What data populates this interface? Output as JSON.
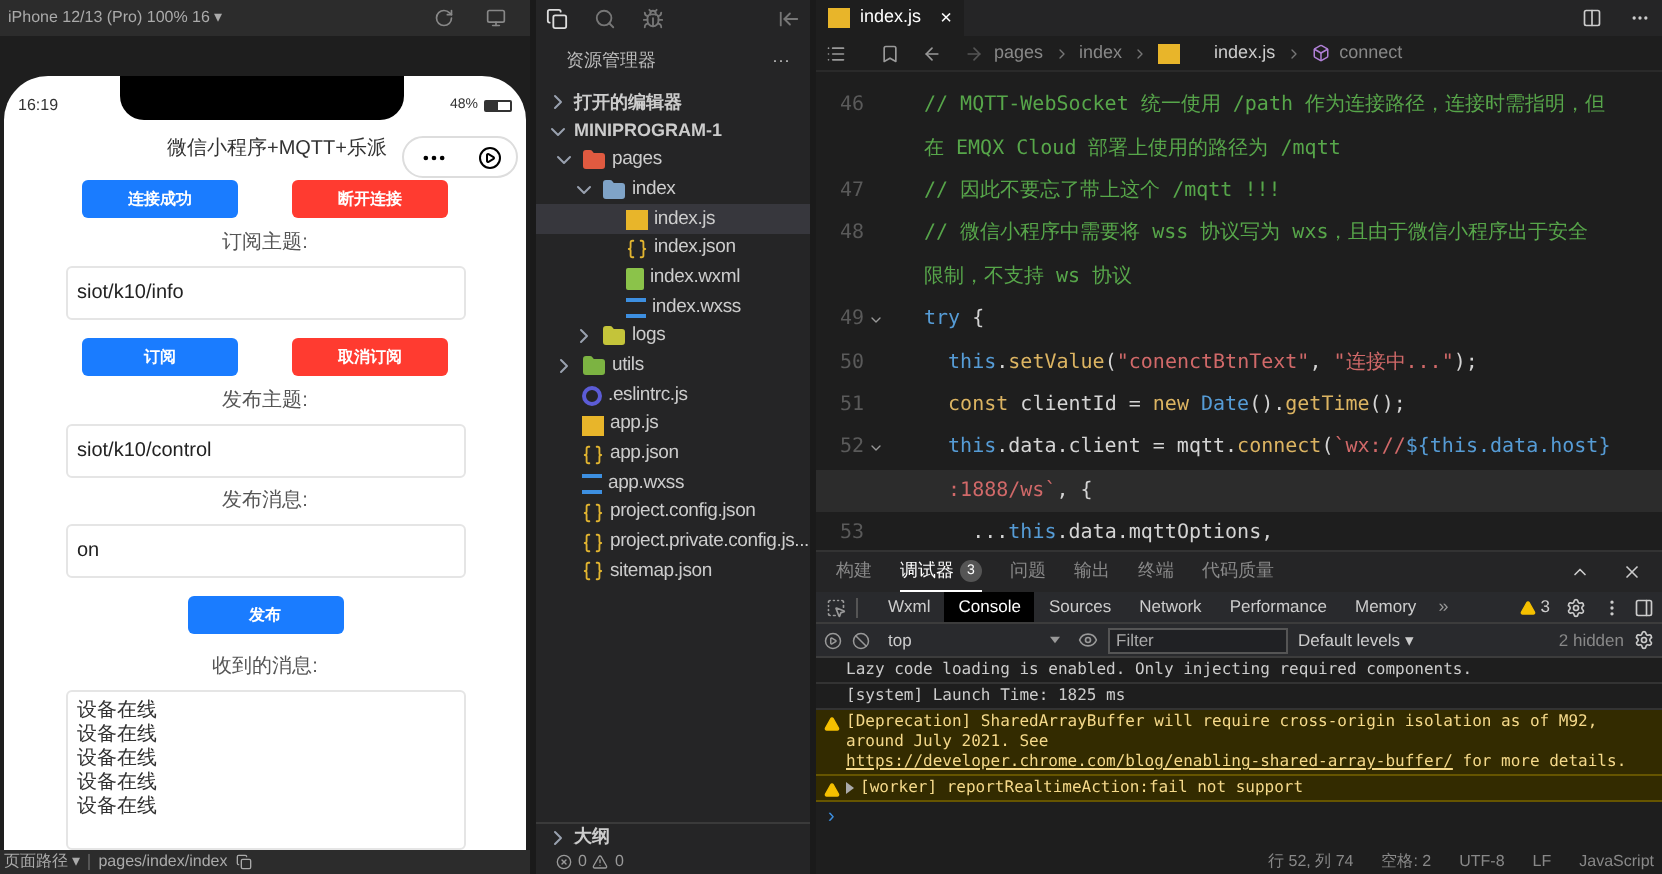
{
  "simulator": {
    "device_menu": "iPhone 12/13 (Pro) 100% 16 ▾",
    "phone": {
      "time": "16:19",
      "battery_text": "48%",
      "battery": {
        "level": 0.48
      },
      "title": "微信小程序+MQTT+乐派",
      "rows": [
        {
          "kind": "buttons",
          "buttons": [
            {
              "label": "连接成功",
              "color": "#1a7cff"
            },
            {
              "label": "断开连接",
              "color": "#ff3b30"
            }
          ]
        },
        {
          "kind": "field",
          "label": "订阅主题:",
          "value": "siot/k10/info"
        },
        {
          "kind": "buttons",
          "buttons": [
            {
              "label": "订阅",
              "color": "#1a7cff"
            },
            {
              "label": "取消订阅",
              "color": "#ff3b30"
            }
          ]
        },
        {
          "kind": "field",
          "label": "发布主题:",
          "value": "siot/k10/control"
        },
        {
          "kind": "field",
          "label": "发布消息:",
          "value": "on"
        },
        {
          "kind": "buttons",
          "buttons": [
            {
              "label": "发布",
              "color": "#1a7cff"
            }
          ]
        },
        {
          "kind": "messages",
          "label": "收到的消息:",
          "lines": [
            "设备在线",
            "设备在线",
            "设备在线",
            "设备在线",
            "设备在线"
          ]
        }
      ]
    },
    "path_label": "页面路径 ▾",
    "path": "pages/index/index"
  },
  "explorer": {
    "title": "资源管理器",
    "more": "···",
    "sections": [
      {
        "label": "打开的编辑器",
        "expanded": false
      },
      {
        "label": "MINIPROGRAM-1",
        "expanded": true
      }
    ],
    "tree": [
      {
        "name": "pages",
        "kind": "folder-pages",
        "expanded": true,
        "selected": false,
        "children": [
          {
            "name": "index",
            "kind": "folder",
            "expanded": true,
            "selected": false,
            "children": [
              {
                "name": "index.js",
                "kind": "js",
                "selected": true
              },
              {
                "name": "index.json",
                "kind": "json",
                "selected": false
              },
              {
                "name": "index.wxml",
                "kind": "wxml",
                "selected": false
              },
              {
                "name": "index.wxss",
                "kind": "wxss",
                "selected": false
              }
            ]
          },
          {
            "name": "logs",
            "kind": "folder-logs",
            "expanded": false,
            "selected": false
          }
        ]
      },
      {
        "name": "utils",
        "kind": "folder-utils",
        "expanded": false,
        "selected": false
      },
      {
        "name": ".eslintrc.js",
        "kind": "eslint",
        "selected": false
      },
      {
        "name": "app.js",
        "kind": "js",
        "selected": false
      },
      {
        "name": "app.json",
        "kind": "json",
        "selected": false
      },
      {
        "name": "app.wxss",
        "kind": "wxss",
        "selected": false
      },
      {
        "name": "project.config.json",
        "kind": "json",
        "selected": false
      },
      {
        "name": "project.private.config.js...",
        "kind": "json",
        "selected": false
      },
      {
        "name": "sitemap.json",
        "kind": "json",
        "selected": false
      }
    ],
    "outline": {
      "label": "大纲",
      "expanded": false
    },
    "errors": "0",
    "warnings": "0"
  },
  "editor": {
    "tab": {
      "label": "index.js",
      "close": "×"
    },
    "breadcrumbs": [
      "pages",
      "index",
      "index.js",
      "connect"
    ],
    "rows": [
      {
        "number": "46",
        "current": false,
        "foldable": false,
        "tokens": [
          {
            "kind": "comment",
            "text": "// MQTT-WebSocket 统一使用 /path 作为连接路径，连接时需指明，但"
          }
        ]
      },
      {
        "current": false,
        "foldable": false,
        "tokens": [
          {
            "kind": "comment",
            "text": "在 EMQX Cloud 部署上使用的路径为 /mqtt"
          }
        ]
      },
      {
        "number": "47",
        "current": false,
        "foldable": false,
        "tokens": [
          {
            "kind": "comment",
            "text": "// 因此不要忘了带上这个 /mqtt !!!"
          }
        ]
      },
      {
        "number": "48",
        "current": false,
        "foldable": false,
        "tokens": [
          {
            "kind": "comment",
            "text": "// 微信小程序中需要将 wss 协议写为 wxs，且由于微信小程序出于安全"
          }
        ]
      },
      {
        "current": false,
        "foldable": false,
        "tokens": [
          {
            "kind": "comment",
            "text": "限制，不支持 ws 协议"
          }
        ]
      },
      {
        "number": "49",
        "current": false,
        "foldable": true,
        "tokens": [
          {
            "kind": "keyword",
            "text": "try"
          },
          {
            "kind": "plain",
            "text": " {"
          }
        ]
      },
      {
        "number": "50",
        "current": false,
        "foldable": false,
        "tokens": [
          {
            "kind": "keyword",
            "text": "  this"
          },
          {
            "kind": "plain",
            "text": "."
          },
          {
            "kind": "func",
            "text": "setValue"
          },
          {
            "kind": "plain",
            "text": "("
          },
          {
            "kind": "string",
            "text": "\"conenctBtnText\""
          },
          {
            "kind": "plain",
            "text": ", "
          },
          {
            "kind": "string",
            "text": "\"连接中...\""
          },
          {
            "kind": "plain",
            "text": ");"
          }
        ]
      },
      {
        "number": "51",
        "current": false,
        "foldable": false,
        "tokens": [
          {
            "kind": "func",
            "text": "  const"
          },
          {
            "kind": "plain",
            "text": " clientId = "
          },
          {
            "kind": "func",
            "text": "new"
          },
          {
            "kind": "keyword",
            "text": " Date"
          },
          {
            "kind": "plain",
            "text": "()."
          },
          {
            "kind": "func",
            "text": "getTime"
          },
          {
            "kind": "plain",
            "text": "();"
          }
        ]
      },
      {
        "number": "52",
        "current": false,
        "foldable": true,
        "tokens": [
          {
            "kind": "keyword",
            "text": "  this"
          },
          {
            "kind": "plain",
            "text": ".data.client = mqtt."
          },
          {
            "kind": "func",
            "text": "connect"
          },
          {
            "kind": "plain",
            "text": "("
          },
          {
            "kind": "string",
            "text": "`wx://"
          },
          {
            "kind": "keyword",
            "text": "${this.data.host}"
          }
        ]
      },
      {
        "current": true,
        "foldable": false,
        "tokens": [
          {
            "kind": "string",
            "text": "  :1888/ws`"
          },
          {
            "kind": "plain",
            "text": ", {"
          }
        ]
      },
      {
        "number": "53",
        "current": false,
        "foldable": false,
        "tokens": [
          {
            "kind": "plain",
            "text": "    ..."
          },
          {
            "kind": "keyword",
            "text": "this"
          },
          {
            "kind": "plain",
            "text": ".data.mqttOptions,"
          }
        ]
      }
    ]
  },
  "panel": {
    "tabs": [
      {
        "label": "构建",
        "selected": false
      },
      {
        "label": "调试器",
        "selected": true,
        "badge": "3"
      },
      {
        "label": "问题",
        "selected": false
      },
      {
        "label": "输出",
        "selected": false
      },
      {
        "label": "终端",
        "selected": false
      },
      {
        "label": "代码质量",
        "selected": false
      }
    ],
    "devtools_tabs": [
      {
        "label": "Wxml",
        "selected": false
      },
      {
        "label": "Console",
        "selected": true
      },
      {
        "label": "Sources",
        "selected": false
      },
      {
        "label": "Network",
        "selected": false
      },
      {
        "label": "Performance",
        "selected": false
      },
      {
        "label": "Memory",
        "selected": false
      }
    ],
    "more_tabs": "»",
    "warning_count": "3",
    "context": "top",
    "filter_placeholder": "Filter",
    "levels": "Default levels ▾",
    "hidden": "2 hidden",
    "messages": [
      {
        "kind": "log",
        "expandable": false,
        "text": "Lazy code loading is enabled. Only injecting required components."
      },
      {
        "kind": "log",
        "expandable": false,
        "text": "[system] Launch Time: 1825 ms"
      },
      {
        "kind": "warning",
        "expandable": false,
        "text": "[Deprecation] SharedArrayBuffer will require cross-origin isolation as of M92, around July 2021. See ",
        "link": "https://developer.chrome.com/blog/enabling-shared-array-buffer/",
        "after": " for more details."
      },
      {
        "kind": "warning",
        "expandable": true,
        "text": "[worker] reportRealtimeAction:fail not support"
      }
    ],
    "prompt": "›"
  },
  "status_bar": [
    "行 52, 列 74",
    "空格: 2",
    "UTF-8",
    "LF",
    "JavaScript"
  ]
}
